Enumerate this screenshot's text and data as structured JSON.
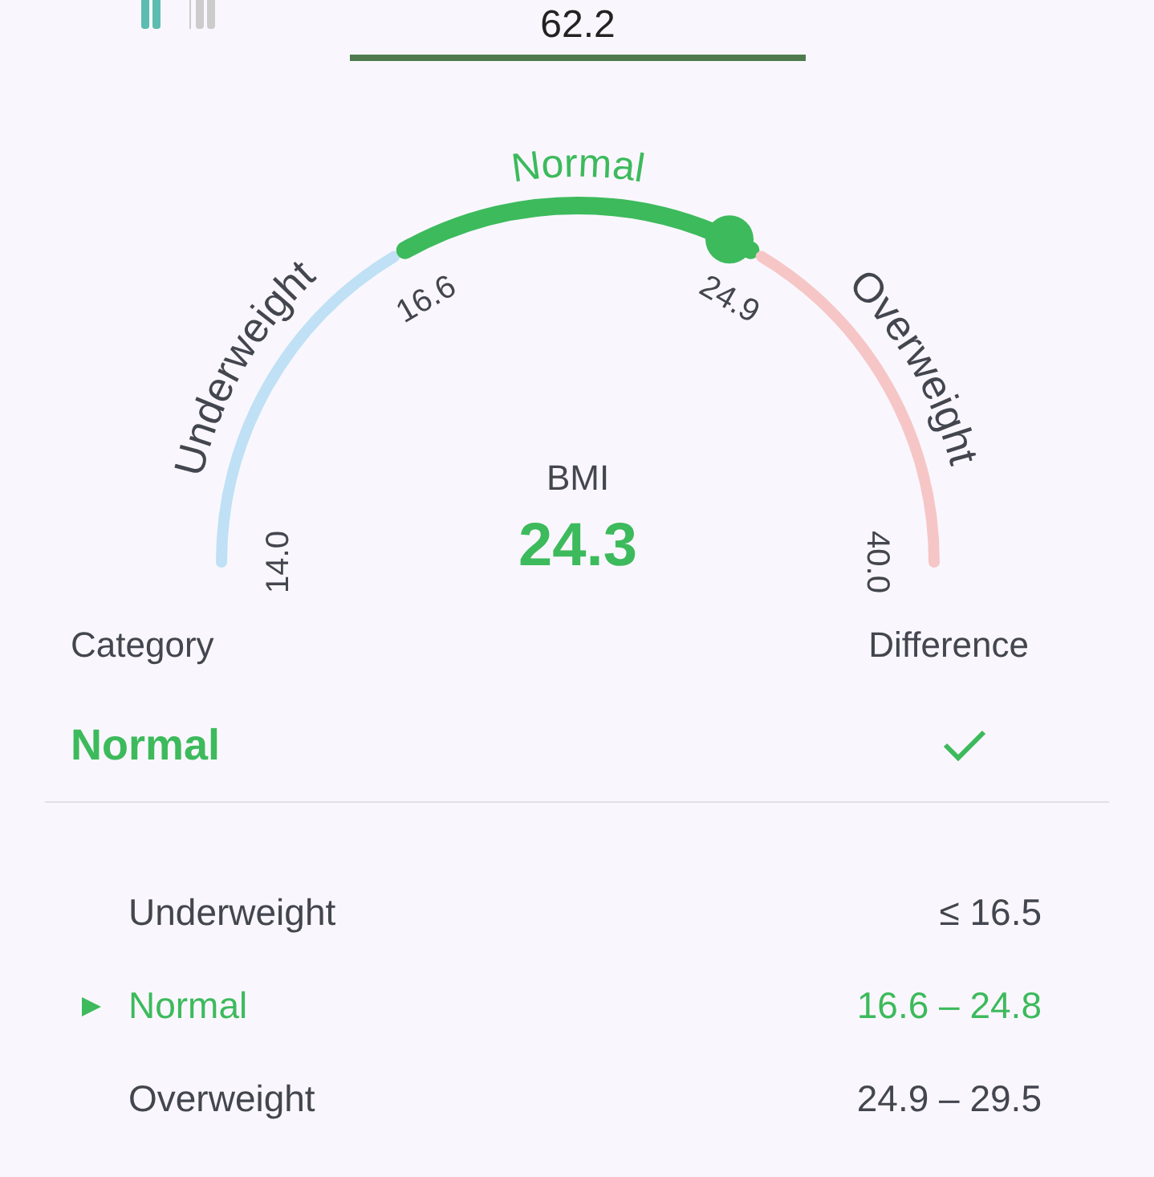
{
  "top_tab": {
    "value": "62.2",
    "selected": true
  },
  "gauge": {
    "segments": [
      {
        "label": "Underweight",
        "color": "#bfe0f5",
        "active": false
      },
      {
        "label": "Normal",
        "color": "#3dba5c",
        "active": true
      },
      {
        "label": "Overweight",
        "color": "#f6c6c6",
        "active": false
      }
    ],
    "ticks": [
      "14.0",
      "16.6",
      "24.9",
      "40.0"
    ],
    "level": 0.64,
    "title": "BMI",
    "value": "24.3"
  },
  "summary": {
    "columns": [
      "Category",
      "Difference"
    ],
    "category": "Normal",
    "within_range": true
  },
  "ranges": [
    {
      "name": "Underweight",
      "range": "≤ 16.5",
      "selected": false
    },
    {
      "name": "Normal",
      "range": "16.6 – 24.8",
      "selected": true
    },
    {
      "name": "Overweight",
      "range": "24.9 – 29.5",
      "selected": false
    }
  ]
}
